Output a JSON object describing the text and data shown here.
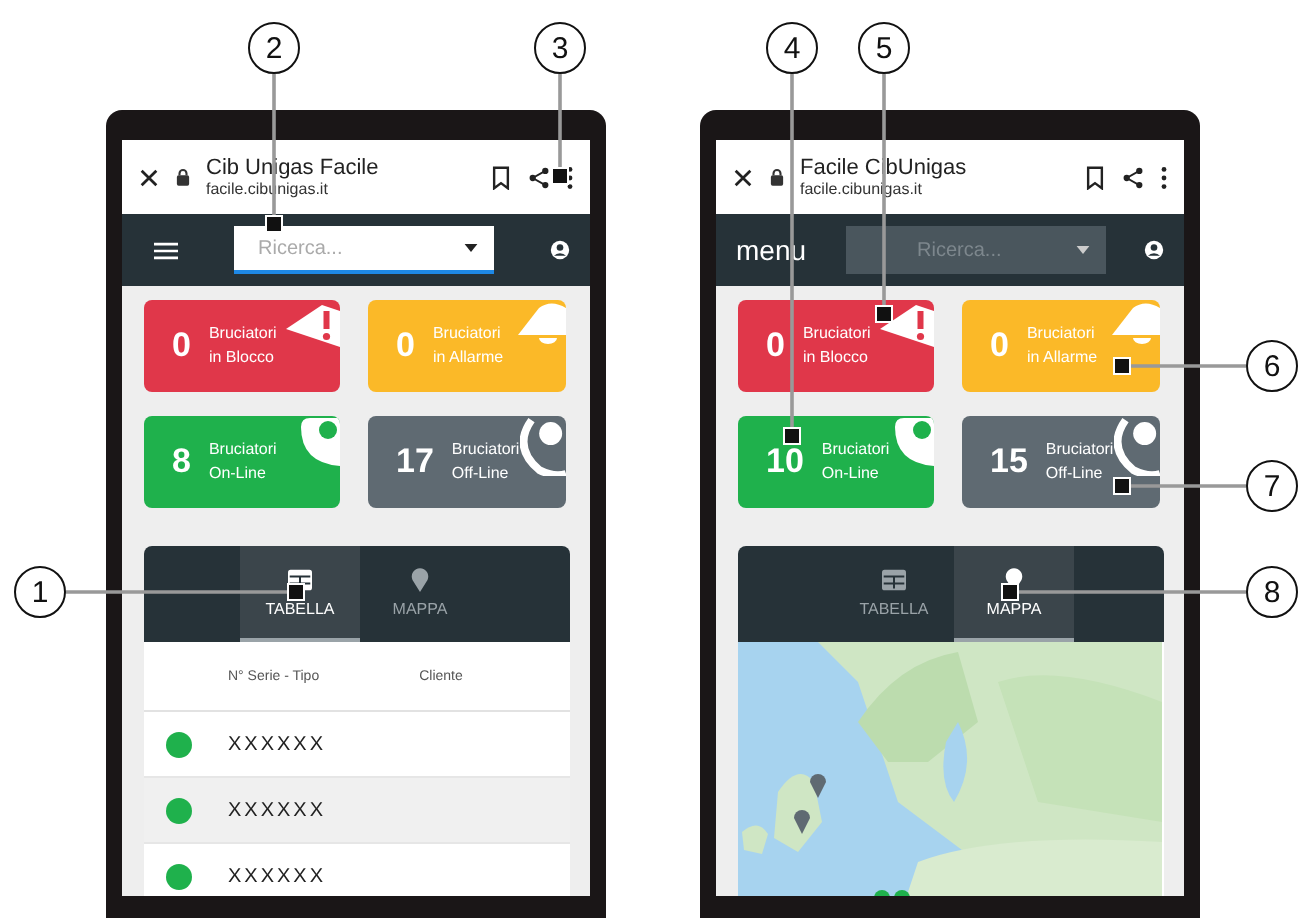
{
  "phones": [
    {
      "browser": {
        "title": "Cib Unigas Facile",
        "url": "facile.cibunigas.it"
      },
      "menu": {
        "kind": "icon"
      },
      "search": {
        "placeholder": "Ricerca...",
        "kind": "light"
      },
      "cards": [
        {
          "count": "0",
          "label": "Bruciatori\nin Blocco",
          "kind": "blocked",
          "color": "#e0374a"
        },
        {
          "count": "0",
          "label": "Bruciatori\nin Allarme",
          "kind": "alarm",
          "color": "#fbb928"
        },
        {
          "count": "8",
          "label": "Bruciatori\nOn-Line",
          "kind": "online",
          "color": "#1fb14c"
        },
        {
          "count": "17",
          "label": "Bruciatori\nOff-Line",
          "kind": "offline",
          "color": "#5f6a72"
        }
      ],
      "tabs": [
        {
          "label": "TABELLA",
          "selected": true
        },
        {
          "label": "MAPPA",
          "selected": false
        }
      ],
      "content": {
        "kind": "table",
        "columns": [
          "N° Serie - Tipo",
          "Cliente"
        ],
        "rows": [
          {
            "serial": "XXXXXX",
            "color": "#1fb14c"
          },
          {
            "serial": "XXXXXX",
            "color": "#1fb14c"
          },
          {
            "serial": "XXXXXX",
            "color": "#1fb14c"
          }
        ]
      }
    },
    {
      "browser": {
        "title": "Facile CibUnigas",
        "url": "facile.cibunigas.it"
      },
      "menu": {
        "kind": "text",
        "label": "menu"
      },
      "search": {
        "placeholder": "Ricerca...",
        "kind": "dark"
      },
      "cards": [
        {
          "count": "0",
          "label": "Bruciatori\nin Blocco",
          "kind": "blocked",
          "color": "#e0374a"
        },
        {
          "count": "0",
          "label": "Bruciatori\nin Allarme",
          "kind": "alarm",
          "color": "#fbb928"
        },
        {
          "count": "10",
          "label": "Bruciatori\nOn-Line",
          "kind": "online",
          "color": "#1fb14c"
        },
        {
          "count": "15",
          "label": "Bruciatori\nOff-Line",
          "kind": "offline",
          "color": "#5f6a72"
        }
      ],
      "tabs": [
        {
          "label": "TABELLA",
          "selected": false
        },
        {
          "label": "MAPPA",
          "selected": true
        }
      ],
      "content": {
        "kind": "map"
      }
    }
  ],
  "callouts": [
    {
      "label": "1"
    },
    {
      "label": "2"
    },
    {
      "label": "3"
    },
    {
      "label": "4"
    },
    {
      "label": "5"
    },
    {
      "label": "6"
    },
    {
      "label": "7"
    },
    {
      "label": "8"
    }
  ]
}
